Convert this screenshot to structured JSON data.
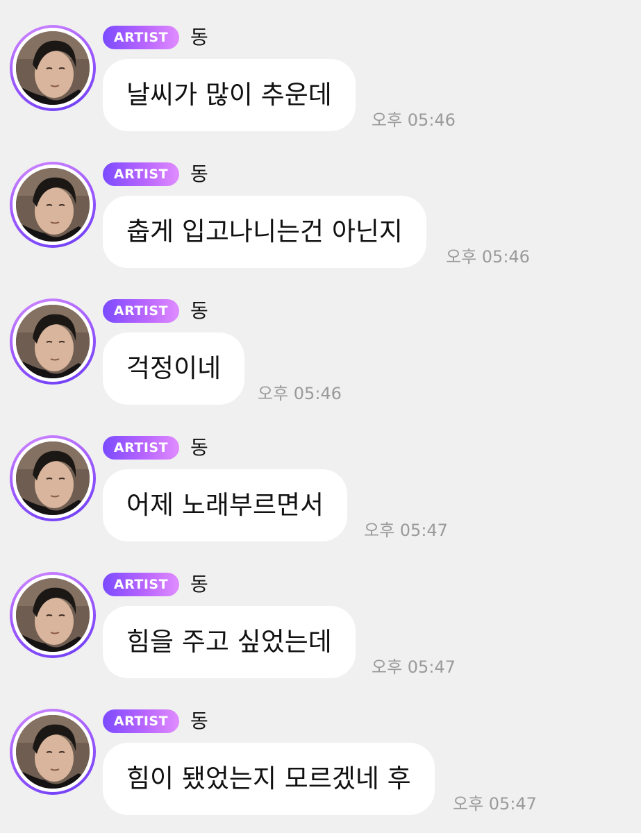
{
  "chat": {
    "messages": [
      {
        "badge": "ARTIST",
        "sender": "동",
        "text": "날씨가 많이 추운데",
        "time": "오후 05:46"
      },
      {
        "badge": "ARTIST",
        "sender": "동",
        "text": "춥게 입고나니는건 아닌지",
        "time": "오후 05:46"
      },
      {
        "badge": "ARTIST",
        "sender": "동",
        "text": "걱정이네",
        "time": "오후 05:46"
      },
      {
        "badge": "ARTIST",
        "sender": "동",
        "text": "어제 노래부르면서",
        "time": "오후 05:47"
      },
      {
        "badge": "ARTIST",
        "sender": "동",
        "text": "힘을 주고 싶었는데",
        "time": "오후 05:47"
      },
      {
        "badge": "ARTIST",
        "sender": "동",
        "text": "힘이 됐었는지 모르겠네 후",
        "time": "오후 05:47"
      }
    ]
  },
  "colors": {
    "background": "#f0f0f0",
    "bubble": "#ffffff",
    "badge_gradient_start": "#7b4bff",
    "badge_gradient_end": "#e08cff",
    "avatar_ring": "#a05cff",
    "timestamp": "#9a9a9a"
  }
}
